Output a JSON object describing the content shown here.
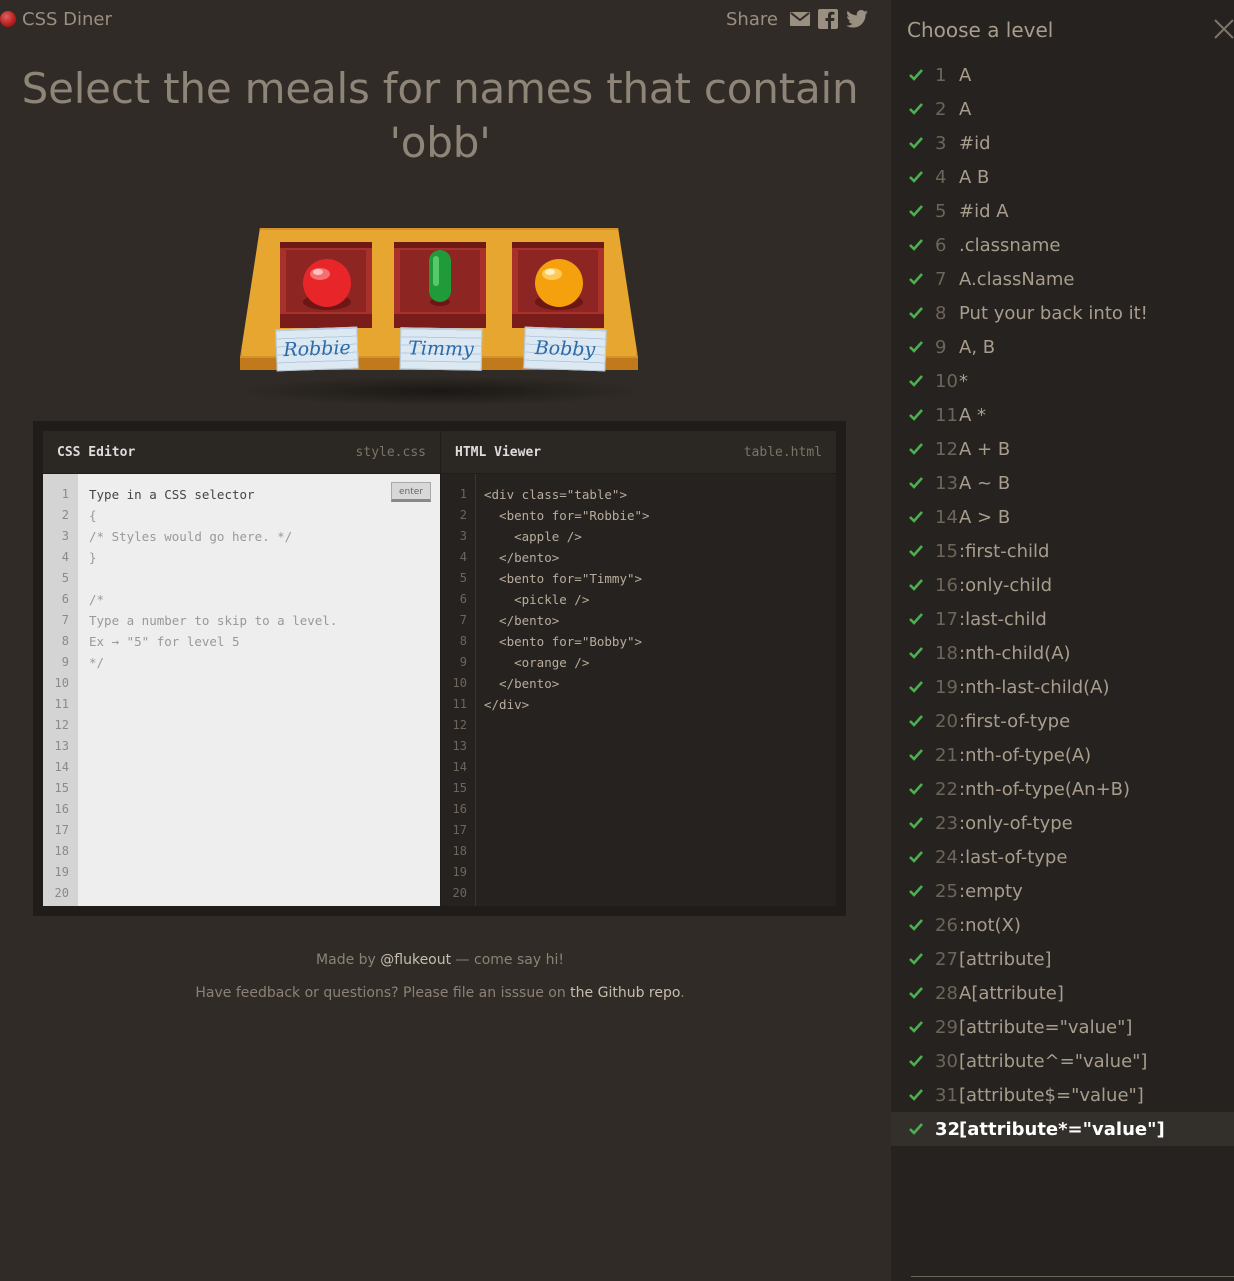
{
  "app": {
    "title": "CSS Diner"
  },
  "share": {
    "label": "Share",
    "icons": [
      "mail-icon",
      "facebook-icon",
      "twitter-icon"
    ]
  },
  "level": {
    "instruction_line1": "Select the meals for names that contain",
    "instruction_line2": "'obb'"
  },
  "table": {
    "bentos": [
      {
        "for": "Robbie",
        "item": "apple",
        "item_color": "#e8262a"
      },
      {
        "for": "Timmy",
        "item": "pickle",
        "item_color": "#1f9b3a"
      },
      {
        "for": "Bobby",
        "item": "orange",
        "item_color": "#f5a10e"
      }
    ]
  },
  "css_editor": {
    "title": "CSS Editor",
    "filename": "style.css",
    "enter_label": "enter",
    "line_numbers": [
      "1",
      "2",
      "3",
      "4",
      "5",
      "6",
      "7",
      "8",
      "9",
      "10",
      "11",
      "12",
      "13",
      "14",
      "15",
      "16",
      "17",
      "18",
      "19",
      "20"
    ],
    "lines": [
      "Type in a CSS selector",
      "{",
      "/* Styles would go here. */",
      "}",
      "",
      "/*",
      "Type a number to skip to a level.",
      "Ex → \"5\" for level 5",
      "*/"
    ]
  },
  "html_viewer": {
    "title": "HTML Viewer",
    "filename": "table.html",
    "line_numbers": [
      "1",
      "2",
      "3",
      "4",
      "5",
      "6",
      "7",
      "8",
      "9",
      "10",
      "11",
      "12",
      "13",
      "14",
      "15",
      "16",
      "17",
      "18",
      "19",
      "20"
    ],
    "lines": [
      "<div class=\"table\">",
      "  <bento for=\"Robbie\">",
      "    <apple />",
      "  </bento>",
      "  <bento for=\"Timmy\">",
      "    <pickle />",
      "  </bento>",
      "  <bento for=\"Bobby\">",
      "    <orange />",
      "  </bento>",
      "</div>"
    ]
  },
  "footer": {
    "made_by_prefix": "Made by ",
    "made_by_link": "@flukeout",
    "made_by_suffix": " — come say hi!",
    "feedback_prefix": "Have feedback or questions? Please file an isssue on ",
    "feedback_link": "the Github repo",
    "feedback_suffix": "."
  },
  "sidebar": {
    "title": "Choose a level",
    "current_level": 32,
    "levels": [
      {
        "num": "1",
        "name": "A"
      },
      {
        "num": "2",
        "name": "A"
      },
      {
        "num": "3",
        "name": "#id"
      },
      {
        "num": "4",
        "name": "A  B"
      },
      {
        "num": "5",
        "name": "#id  A"
      },
      {
        "num": "6",
        "name": ".classname"
      },
      {
        "num": "7",
        "name": "A.className"
      },
      {
        "num": "8",
        "name": "Put your back into it!"
      },
      {
        "num": "9",
        "name": "A, B"
      },
      {
        "num": "10",
        "name": "*"
      },
      {
        "num": "11",
        "name": "A  *"
      },
      {
        "num": "12",
        "name": "A + B"
      },
      {
        "num": "13",
        "name": "A ~ B"
      },
      {
        "num": "14",
        "name": "A > B"
      },
      {
        "num": "15",
        "name": ":first-child"
      },
      {
        "num": "16",
        "name": ":only-child"
      },
      {
        "num": "17",
        "name": ":last-child"
      },
      {
        "num": "18",
        "name": ":nth-child(A)"
      },
      {
        "num": "19",
        "name": ":nth-last-child(A)"
      },
      {
        "num": "20",
        "name": ":first-of-type"
      },
      {
        "num": "21",
        "name": ":nth-of-type(A)"
      },
      {
        "num": "22",
        "name": ":nth-of-type(An+B)"
      },
      {
        "num": "23",
        "name": ":only-of-type"
      },
      {
        "num": "24",
        "name": ":last-of-type"
      },
      {
        "num": "25",
        "name": ":empty"
      },
      {
        "num": "26",
        "name": ":not(X)"
      },
      {
        "num": "27",
        "name": "[attribute]"
      },
      {
        "num": "28",
        "name": "A[attribute]"
      },
      {
        "num": "29",
        "name": "[attribute=\"value\"]"
      },
      {
        "num": "30",
        "name": "[attribute^=\"value\"]"
      },
      {
        "num": "31",
        "name": "[attribute$=\"value\"]"
      },
      {
        "num": "32",
        "name": "[attribute*=\"value\"]"
      }
    ]
  },
  "colors": {
    "background": "#302b26",
    "sidebar": "#26221f",
    "check": "#4caf50",
    "table": "#e6a630",
    "bento": "#a8312c"
  }
}
